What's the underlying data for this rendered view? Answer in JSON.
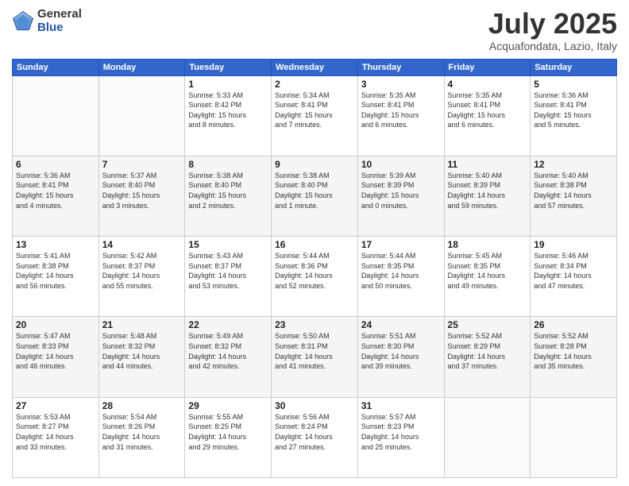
{
  "logo": {
    "general": "General",
    "blue": "Blue"
  },
  "header": {
    "month": "July 2025",
    "location": "Acquafondata, Lazio, Italy"
  },
  "weekdays": [
    "Sunday",
    "Monday",
    "Tuesday",
    "Wednesday",
    "Thursday",
    "Friday",
    "Saturday"
  ],
  "weeks": [
    [
      {
        "day": "",
        "info": ""
      },
      {
        "day": "",
        "info": ""
      },
      {
        "day": "1",
        "info": "Sunrise: 5:33 AM\nSunset: 8:42 PM\nDaylight: 15 hours\nand 8 minutes."
      },
      {
        "day": "2",
        "info": "Sunrise: 5:34 AM\nSunset: 8:41 PM\nDaylight: 15 hours\nand 7 minutes."
      },
      {
        "day": "3",
        "info": "Sunrise: 5:35 AM\nSunset: 8:41 PM\nDaylight: 15 hours\nand 6 minutes."
      },
      {
        "day": "4",
        "info": "Sunrise: 5:35 AM\nSunset: 8:41 PM\nDaylight: 15 hours\nand 6 minutes."
      },
      {
        "day": "5",
        "info": "Sunrise: 5:36 AM\nSunset: 8:41 PM\nDaylight: 15 hours\nand 5 minutes."
      }
    ],
    [
      {
        "day": "6",
        "info": "Sunrise: 5:36 AM\nSunset: 8:41 PM\nDaylight: 15 hours\nand 4 minutes."
      },
      {
        "day": "7",
        "info": "Sunrise: 5:37 AM\nSunset: 8:40 PM\nDaylight: 15 hours\nand 3 minutes."
      },
      {
        "day": "8",
        "info": "Sunrise: 5:38 AM\nSunset: 8:40 PM\nDaylight: 15 hours\nand 2 minutes."
      },
      {
        "day": "9",
        "info": "Sunrise: 5:38 AM\nSunset: 8:40 PM\nDaylight: 15 hours\nand 1 minute."
      },
      {
        "day": "10",
        "info": "Sunrise: 5:39 AM\nSunset: 8:39 PM\nDaylight: 15 hours\nand 0 minutes."
      },
      {
        "day": "11",
        "info": "Sunrise: 5:40 AM\nSunset: 8:39 PM\nDaylight: 14 hours\nand 59 minutes."
      },
      {
        "day": "12",
        "info": "Sunrise: 5:40 AM\nSunset: 8:38 PM\nDaylight: 14 hours\nand 57 minutes."
      }
    ],
    [
      {
        "day": "13",
        "info": "Sunrise: 5:41 AM\nSunset: 8:38 PM\nDaylight: 14 hours\nand 56 minutes."
      },
      {
        "day": "14",
        "info": "Sunrise: 5:42 AM\nSunset: 8:37 PM\nDaylight: 14 hours\nand 55 minutes."
      },
      {
        "day": "15",
        "info": "Sunrise: 5:43 AM\nSunset: 8:37 PM\nDaylight: 14 hours\nand 53 minutes."
      },
      {
        "day": "16",
        "info": "Sunrise: 5:44 AM\nSunset: 8:36 PM\nDaylight: 14 hours\nand 52 minutes."
      },
      {
        "day": "17",
        "info": "Sunrise: 5:44 AM\nSunset: 8:35 PM\nDaylight: 14 hours\nand 50 minutes."
      },
      {
        "day": "18",
        "info": "Sunrise: 5:45 AM\nSunset: 8:35 PM\nDaylight: 14 hours\nand 49 minutes."
      },
      {
        "day": "19",
        "info": "Sunrise: 5:46 AM\nSunset: 8:34 PM\nDaylight: 14 hours\nand 47 minutes."
      }
    ],
    [
      {
        "day": "20",
        "info": "Sunrise: 5:47 AM\nSunset: 8:33 PM\nDaylight: 14 hours\nand 46 minutes."
      },
      {
        "day": "21",
        "info": "Sunrise: 5:48 AM\nSunset: 8:32 PM\nDaylight: 14 hours\nand 44 minutes."
      },
      {
        "day": "22",
        "info": "Sunrise: 5:49 AM\nSunset: 8:32 PM\nDaylight: 14 hours\nand 42 minutes."
      },
      {
        "day": "23",
        "info": "Sunrise: 5:50 AM\nSunset: 8:31 PM\nDaylight: 14 hours\nand 41 minutes."
      },
      {
        "day": "24",
        "info": "Sunrise: 5:51 AM\nSunset: 8:30 PM\nDaylight: 14 hours\nand 39 minutes."
      },
      {
        "day": "25",
        "info": "Sunrise: 5:52 AM\nSunset: 8:29 PM\nDaylight: 14 hours\nand 37 minutes."
      },
      {
        "day": "26",
        "info": "Sunrise: 5:52 AM\nSunset: 8:28 PM\nDaylight: 14 hours\nand 35 minutes."
      }
    ],
    [
      {
        "day": "27",
        "info": "Sunrise: 5:53 AM\nSunset: 8:27 PM\nDaylight: 14 hours\nand 33 minutes."
      },
      {
        "day": "28",
        "info": "Sunrise: 5:54 AM\nSunset: 8:26 PM\nDaylight: 14 hours\nand 31 minutes."
      },
      {
        "day": "29",
        "info": "Sunrise: 5:55 AM\nSunset: 8:25 PM\nDaylight: 14 hours\nand 29 minutes."
      },
      {
        "day": "30",
        "info": "Sunrise: 5:56 AM\nSunset: 8:24 PM\nDaylight: 14 hours\nand 27 minutes."
      },
      {
        "day": "31",
        "info": "Sunrise: 5:57 AM\nSunset: 8:23 PM\nDaylight: 14 hours\nand 25 minutes."
      },
      {
        "day": "",
        "info": ""
      },
      {
        "day": "",
        "info": ""
      }
    ]
  ]
}
